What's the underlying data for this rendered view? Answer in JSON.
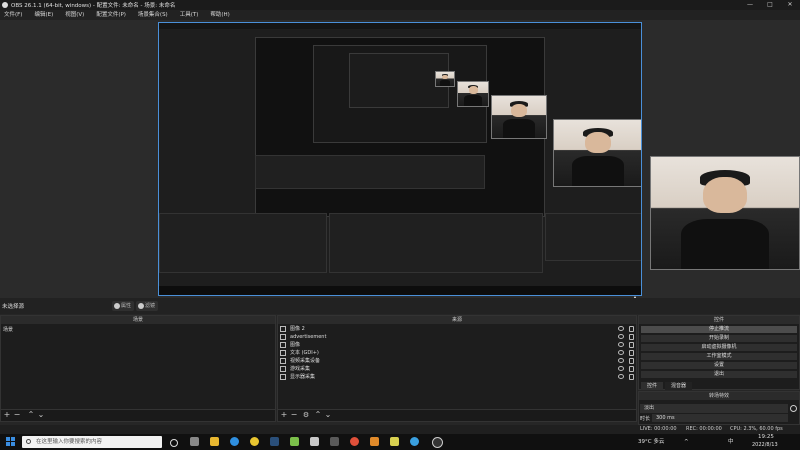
{
  "window": {
    "title": "OBS 26.1.1 (64-bit, windows) - 配置文件: 未命名 - 场景: 未命名",
    "min": "—",
    "max": "□",
    "close": "✕"
  },
  "menu": [
    "文件(F)",
    "编辑(E)",
    "视图(V)",
    "配置文件(P)",
    "场景集合(S)",
    "工具(T)",
    "帮助(H)"
  ],
  "scene_bar": {
    "no_source": "未选择源",
    "properties": "属性",
    "filters": "滤镜"
  },
  "scenes": {
    "header": "场景",
    "items": [
      "场景"
    ]
  },
  "sources": {
    "header": "来源",
    "items": [
      {
        "label": "图像 2",
        "icon": "image-icon"
      },
      {
        "label": "advertisement",
        "icon": "text-icon"
      },
      {
        "label": "图像",
        "icon": "image-icon"
      },
      {
        "label": "文本 (GDI+)",
        "icon": "text-icon"
      },
      {
        "label": "视频采集设备",
        "icon": "camera-icon"
      },
      {
        "label": "游戏采集",
        "icon": "game-icon"
      },
      {
        "label": "显示器采集",
        "icon": "monitor-icon"
      }
    ]
  },
  "controls": {
    "header": "控件",
    "buttons": [
      "停止推流",
      "开始录制",
      "启动虚拟摄像机",
      "工作室模式",
      "设置",
      "退出"
    ]
  },
  "dock_tabs": [
    "控件",
    "混音器"
  ],
  "transitions": {
    "header": "转场特效",
    "selected": "淡出",
    "duration_label": "时长",
    "duration_value": "300 ms"
  },
  "status": {
    "live": "LIVE: 00:00:00",
    "rec": "REC: 00:00:00",
    "cpu": "CPU: 2.3%, 60.00 fps"
  },
  "taskbar": {
    "search_placeholder": "在这里输入你要搜索的内容",
    "weather": "39°C 多云",
    "lang": "中",
    "time": "19:25",
    "date": "2022/8/13"
  }
}
